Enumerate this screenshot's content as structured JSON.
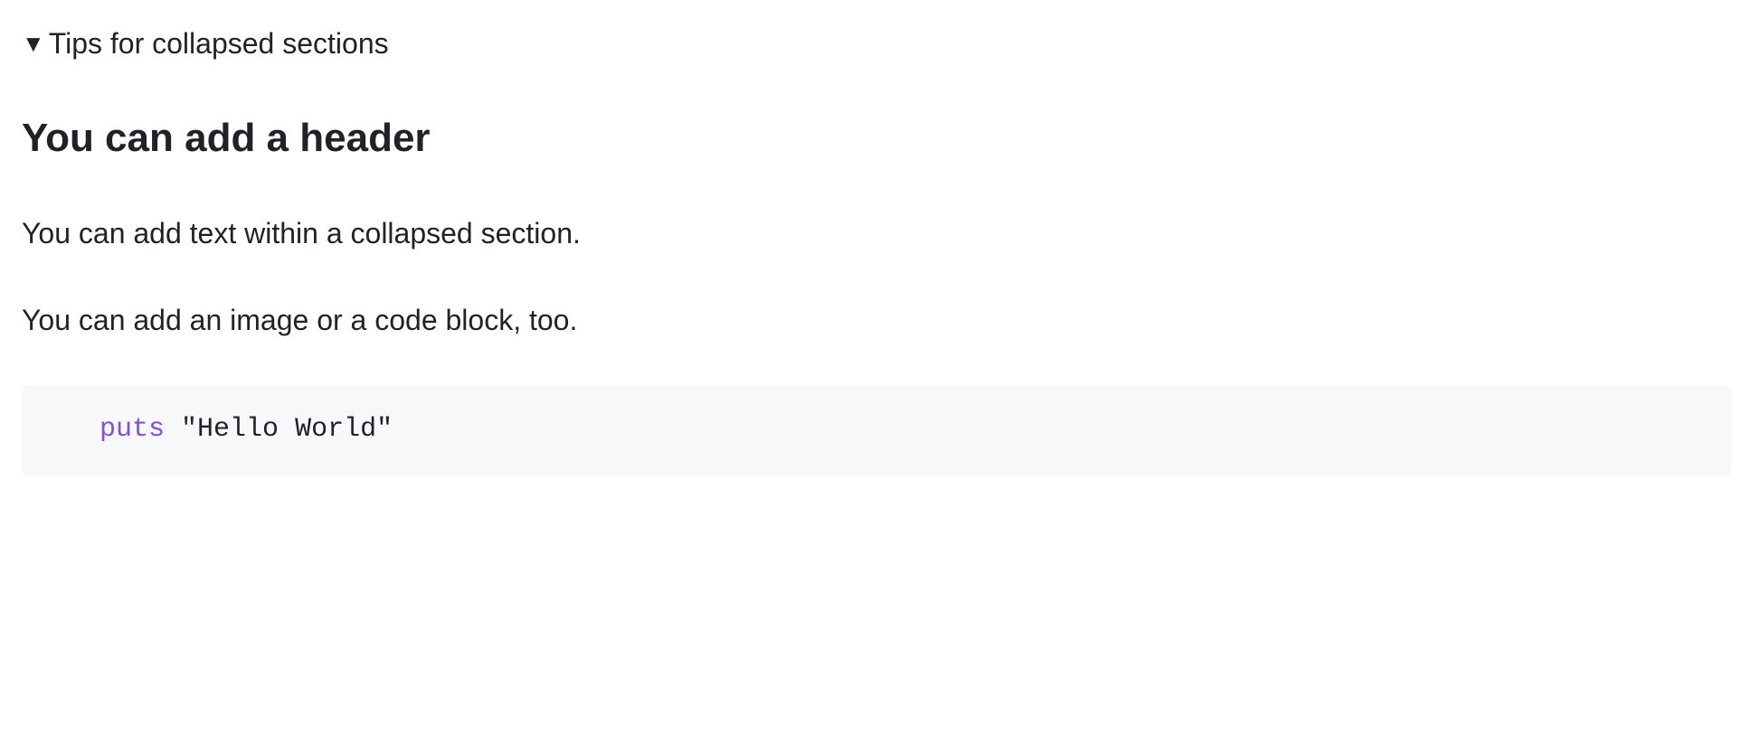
{
  "summary": {
    "label": "Tips for collapsed sections"
  },
  "content": {
    "header": "You can add a header",
    "paragraph1": "You can add text within a collapsed section.",
    "paragraph2": "You can add an image or a code block, too.",
    "code": {
      "indent": "   ",
      "keyword": "puts",
      "space": " ",
      "string": "\"Hello World\""
    }
  }
}
